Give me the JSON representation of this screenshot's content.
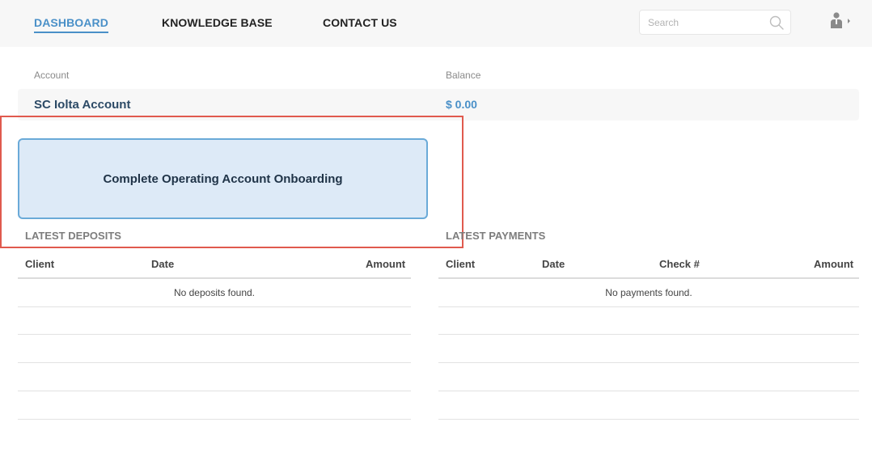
{
  "nav": {
    "items": [
      {
        "label": "DASHBOARD"
      },
      {
        "label": "KNOWLEDGE BASE"
      },
      {
        "label": "CONTACT US"
      }
    ]
  },
  "search": {
    "placeholder": "Search",
    "value": "",
    "icon": "search-icon"
  },
  "user": {
    "icon": "user-icon",
    "caret_icon": "caret-right-icon"
  },
  "account": {
    "account_label": "Account",
    "balance_label": "Balance",
    "name": "SC Iolta Account",
    "balance": "$ 0.00"
  },
  "onboarding": {
    "label": "Complete Operating Account Onboarding"
  },
  "deposits": {
    "title": "LATEST DEPOSITS",
    "columns": [
      "Client",
      "Date",
      "Amount"
    ],
    "empty": "No deposits found."
  },
  "payments": {
    "title": "LATEST PAYMENTS",
    "columns": [
      "Client",
      "Date",
      "Check #",
      "Amount"
    ],
    "empty": "No payments found."
  },
  "colors": {
    "accent": "#4a90c8",
    "highlight_border": "#e05a4e",
    "button_bg": "#ddeaf7",
    "button_border": "#6aaad8"
  }
}
